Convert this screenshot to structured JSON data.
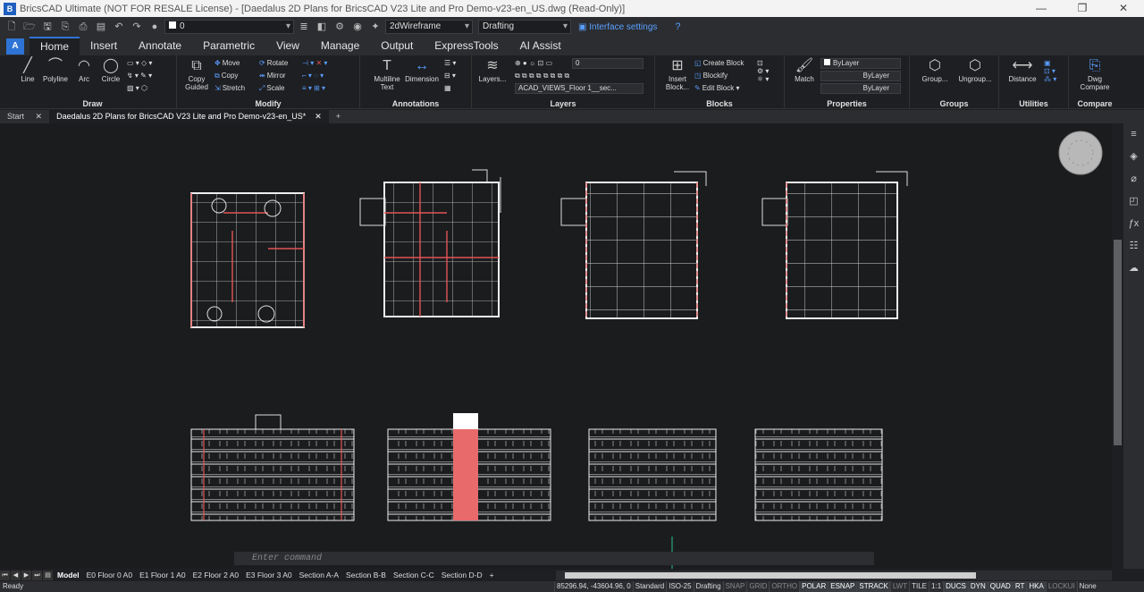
{
  "window": {
    "title": "BricsCAD Ultimate (NOT FOR RESALE License) - [Daedalus 2D Plans for BricsCAD V23 Lite and Pro Demo-v23-en_US.dwg (Read-Only)]",
    "minimize": "—",
    "maximize": "❐",
    "close": "✕"
  },
  "qat": {
    "layer_value": "0",
    "visual_style": "2dWireframe",
    "workspace": "Drafting",
    "interface_settings": "Interface settings"
  },
  "ribbon_tabs": [
    "Home",
    "Insert",
    "Annotate",
    "Parametric",
    "View",
    "Manage",
    "Output",
    "ExpressTools",
    "AI Assist"
  ],
  "ribbon": {
    "draw": {
      "title": "Draw",
      "line": "Line",
      "polyline": "Polyline",
      "arc": "Arc",
      "circle": "Circle"
    },
    "modify": {
      "title": "Modify",
      "copy_guided": "Copy Guided",
      "move": "Move",
      "copy": "Copy",
      "stretch": "Stretch",
      "rotate": "Rotate",
      "mirror": "Mirror",
      "scale": "Scale"
    },
    "annotations": {
      "title": "Annotations",
      "mtext": "Multiline Text",
      "dimension": "Dimension"
    },
    "layers": {
      "title": "Layers",
      "layers": "Layers...",
      "current": "0",
      "view": "ACAD_VIEWS_Floor 1__sec..."
    },
    "blocks": {
      "title": "Blocks",
      "insert": "Insert Block...",
      "create": "Create Block",
      "blockify": "Blockify",
      "edit": "Edit Block"
    },
    "properties": {
      "title": "Properties",
      "match": "Match",
      "color": "ByLayer",
      "linetype": "ByLayer",
      "lineweight": "ByLayer"
    },
    "groups": {
      "title": "Groups",
      "group": "Group...",
      "ungroup": "Ungroup..."
    },
    "utilities": {
      "title": "Utilities",
      "distance": "Distance"
    },
    "compare": {
      "title": "Compare",
      "dwg": "Dwg Compare"
    }
  },
  "doc_tabs": {
    "start": "Start",
    "active": "Daedalus 2D Plans for BricsCAD V23 Lite and Pro Demo-v23-en_US*",
    "close": "✕",
    "add": "+"
  },
  "command": {
    "placeholder": "Enter command"
  },
  "layout_tabs": [
    "Model",
    "E0 Floor 0 A0",
    "E1 Floor 1 A0",
    "E2 Floor 2 A0",
    "E3 Floor 3 A0",
    "Section A-A",
    "Section B-B",
    "Section C-C",
    "Section D-D",
    "+"
  ],
  "status": {
    "ready": "Ready",
    "coords": "85296.94, -43604.96, 0",
    "items": [
      {
        "label": "Standard",
        "state": "plain"
      },
      {
        "label": "ISO-25",
        "state": "plain"
      },
      {
        "label": "Drafting",
        "state": "plain"
      },
      {
        "label": "SNAP",
        "state": "off"
      },
      {
        "label": "GRID",
        "state": "off"
      },
      {
        "label": "ORTHO",
        "state": "off"
      },
      {
        "label": "POLAR",
        "state": "on"
      },
      {
        "label": "ESNAP",
        "state": "on"
      },
      {
        "label": "STRACK",
        "state": "on"
      },
      {
        "label": "LWT",
        "state": "off"
      },
      {
        "label": "TILE",
        "state": "plain"
      },
      {
        "label": "1:1",
        "state": "plain"
      },
      {
        "label": "DUCS",
        "state": "on"
      },
      {
        "label": "DYN",
        "state": "on"
      },
      {
        "label": "QUAD",
        "state": "on"
      },
      {
        "label": "RT",
        "state": "on"
      },
      {
        "label": "HKA",
        "state": "on"
      },
      {
        "label": "LOCKUI",
        "state": "off"
      },
      {
        "label": "None",
        "state": "plain"
      }
    ]
  }
}
